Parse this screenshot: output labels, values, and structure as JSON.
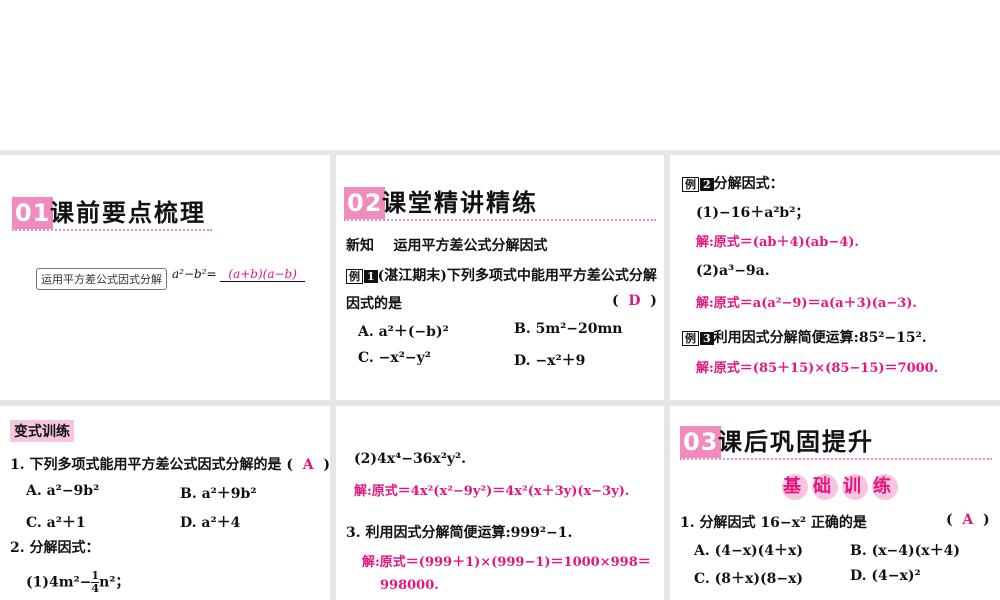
{
  "sections": {
    "s1": {
      "num": "01",
      "title": "课前要点梳理"
    },
    "s2": {
      "num": "02",
      "title": "课堂精讲精练"
    },
    "s3": {
      "num": "03",
      "title": "课后巩固提升"
    }
  },
  "concept": {
    "box": "运用平方差公式因式分解",
    "formula": "a²−b²=",
    "answer": "(a+b)(a−b)"
  },
  "new_knowledge": {
    "label": "新知",
    "topic": "运用平方差公式分解因式"
  },
  "ex1": {
    "badge": "例",
    "num": "1",
    "stem": "(湛江期末)下列多项式中能用平方差公式分解",
    "stem2": "因式的是",
    "paren_open": "(",
    "paren_close": ")",
    "answer": "D",
    "A": "A. a²＋(−b)²",
    "B": "B. 5m²−20mn",
    "C": "C. −x²−y²",
    "D": "D. −x²＋9"
  },
  "ex2": {
    "badge": "例",
    "num": "2",
    "stem": "分解因式：",
    "p1": "(1)−16＋a²b²；",
    "s1": "解:原式＝(ab＋4)(ab−4).",
    "p2": "(2)a³−9a.",
    "s2": "解:原式＝a(a²−9)＝a(a＋3)(a−3)."
  },
  "ex3": {
    "badge": "例",
    "num": "3",
    "stem": "利用因式分解简便运算:85²−15².",
    "solution": "解:原式＝(85＋15)×(85−15)＝7000."
  },
  "variant": {
    "tag": "变式训练",
    "q1": "1. 下列多项式能用平方差公式因式分解的是 (",
    "q1_answer": "A",
    "q1_close": ")",
    "A": "A. a²−9b²",
    "B": "B. a²＋9b²",
    "C": "C. a²＋1",
    "D": "D. a²＋4",
    "q2": "2. 分解因式：",
    "q2_1_pre": "(1)4m²−",
    "q2_1_num": "1",
    "q2_1_den": "4",
    "q2_1_post": "n²；"
  },
  "mid": {
    "p2": "(2)4x⁴−36x²y².",
    "s2": "解:原式＝4x²(x²−9y²)＝4x²(x＋3y)(x−3y).",
    "q3": "3. 利用因式分解简便运算:999²−1.",
    "s3a": "解:原式＝(999＋1)×(999−1)＝1000×998＝",
    "s3b": "998000."
  },
  "basic": {
    "chars": [
      "基",
      "础",
      "训",
      "练"
    ],
    "q1": "1. 分解因式 16−x² 正确的是",
    "q1_open": "(",
    "q1_answer": "A",
    "q1_close": ")",
    "A": "A. (4−x)(4＋x)",
    "B": "B. (x−4)(x＋4)",
    "C": "C. (8＋x)(8−x)",
    "D": "D. (4−x)²"
  },
  "colors": {
    "accent": "#e5157f",
    "section_badge": "#f08bbf",
    "tag_bg": "#f7c6de"
  }
}
